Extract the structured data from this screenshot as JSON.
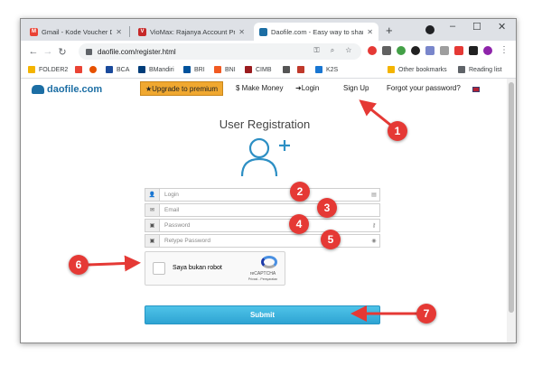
{
  "browser": {
    "tabs": [
      {
        "title": "Gmail - Kode Voucher DAOFILE",
        "fav_color": "#ea4335",
        "fav_glyph": "M",
        "active": false
      },
      {
        "title": "VioMax: Rajanya Account Pro",
        "fav_color": "#c62828",
        "fav_glyph": "V",
        "active": false
      },
      {
        "title": "Daofile.com - Easy way to share",
        "fav_color": "#1c6ea4",
        "fav_glyph": "",
        "active": true
      }
    ],
    "new_tab": "+",
    "window_controls": {
      "minimize": "–",
      "maximize": "☐",
      "close": "✕"
    },
    "url": "daofile.com/register.html",
    "bookmarks": [
      {
        "label": "FOLDER2",
        "color": "#f4b400"
      },
      {
        "label": "",
        "color": "#ea4335"
      },
      {
        "label": "",
        "color": "#e65100"
      },
      {
        "label": "BCA",
        "color": "#1a4a9c"
      },
      {
        "label": "BMandiri",
        "color": "#003d79"
      },
      {
        "label": "BRI",
        "color": "#00529c"
      },
      {
        "label": "BNI",
        "color": "#f15a22"
      },
      {
        "label": "CIMB",
        "color": "#9b1c1f"
      },
      {
        "label": "",
        "color": "#555555"
      },
      {
        "label": "",
        "color": "#c0392b"
      },
      {
        "label": "K2S",
        "color": "#1976d2"
      },
      {
        "label": "Other bookmarks",
        "color": "#f4b400"
      },
      {
        "label": "Reading list",
        "color": "#5f6368"
      }
    ]
  },
  "site": {
    "logo": "daofile.com",
    "nav": {
      "premium": "★Upgrade to premium",
      "make_money": "$ Make Money",
      "login": "➜Login",
      "signup": "Sign Up",
      "forgot": "Forgot your password?"
    },
    "heading": "User Registration",
    "form": {
      "login_placeholder": "Login",
      "email_placeholder": "Email",
      "password_placeholder": "Password",
      "retype_placeholder": "Retype Password"
    },
    "captcha": {
      "label": "Saya bukan robot",
      "brand": "reCAPTCHA",
      "terms": "Privasi - Persyaratan"
    },
    "submit": "Submit"
  },
  "annotations": {
    "badges": [
      "1",
      "2",
      "3",
      "4",
      "5",
      "6",
      "7"
    ],
    "color": "#e53935"
  }
}
